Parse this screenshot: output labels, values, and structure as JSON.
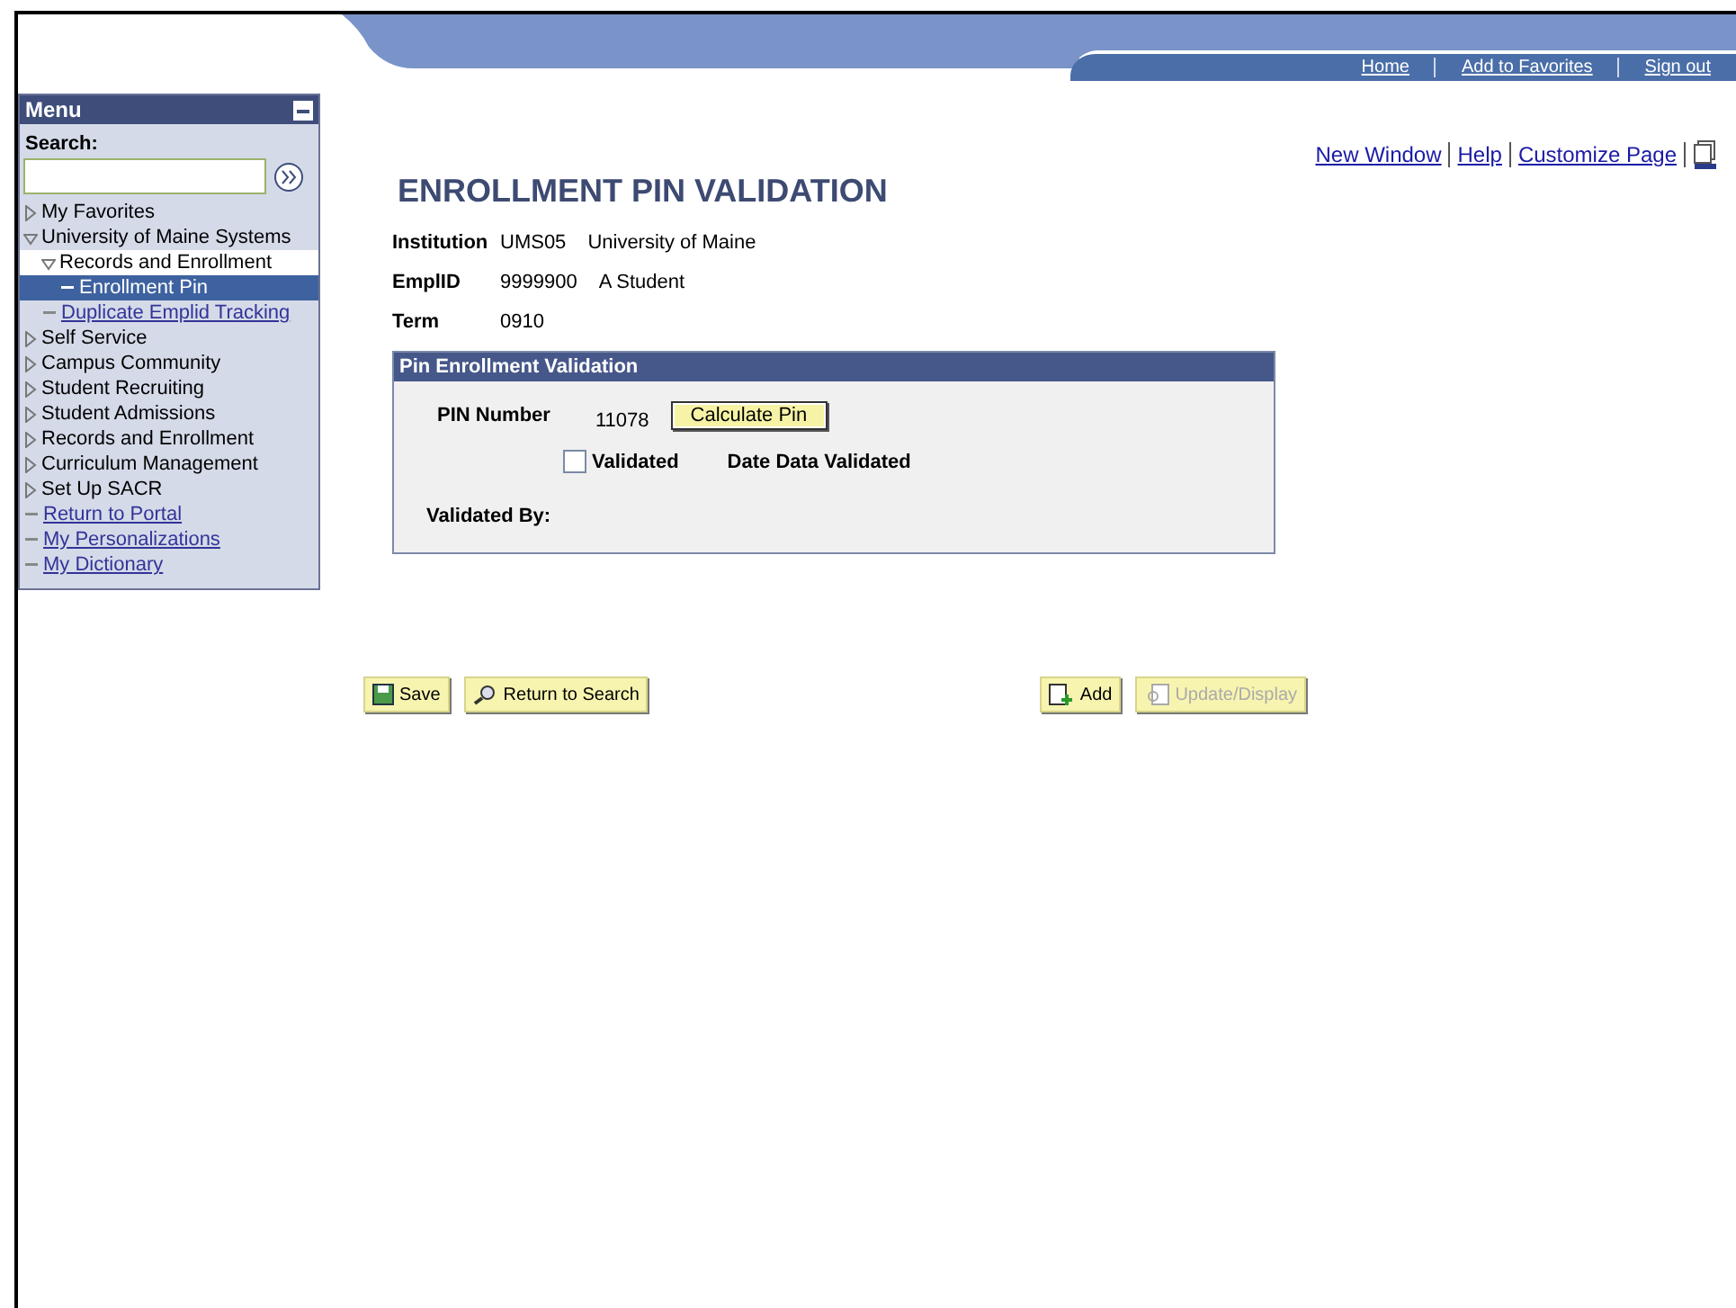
{
  "header": {
    "nav_links": [
      "Home",
      "Add to Favorites",
      "Sign out"
    ],
    "page_links": [
      "New Window",
      "Help",
      "Customize Page"
    ]
  },
  "menu": {
    "title": "Menu",
    "search_label": "Search:",
    "items": [
      {
        "label": "My Favorites",
        "kind": "folder",
        "expanded": false,
        "active": false,
        "selected": false
      },
      {
        "label": "University of Maine Systems",
        "kind": "folder",
        "expanded": true,
        "active": false,
        "selected": false,
        "children": [
          {
            "label": "Records and Enrollment",
            "kind": "folder",
            "expanded": true,
            "active": true,
            "selected": false,
            "children": [
              {
                "label": "Enrollment Pin",
                "kind": "link",
                "active": false,
                "selected": true
              }
            ]
          },
          {
            "label": "Duplicate Emplid Tracking",
            "kind": "link",
            "active": false,
            "selected": false
          }
        ]
      },
      {
        "label": "Self Service",
        "kind": "folder",
        "expanded": false,
        "active": false,
        "selected": false
      },
      {
        "label": "Campus Community",
        "kind": "folder",
        "expanded": false,
        "active": false,
        "selected": false
      },
      {
        "label": "Student Recruiting",
        "kind": "folder",
        "expanded": false,
        "active": false,
        "selected": false
      },
      {
        "label": "Student Admissions",
        "kind": "folder",
        "expanded": false,
        "active": false,
        "selected": false
      },
      {
        "label": "Records and Enrollment",
        "kind": "folder",
        "expanded": false,
        "active": false,
        "selected": false
      },
      {
        "label": "Curriculum Management",
        "kind": "folder",
        "expanded": false,
        "active": false,
        "selected": false
      },
      {
        "label": "Set Up SACR",
        "kind": "folder",
        "expanded": false,
        "active": false,
        "selected": false
      },
      {
        "label": "Return to Portal",
        "kind": "link",
        "active": false,
        "selected": false
      },
      {
        "label": "My Personalizations",
        "kind": "link",
        "active": false,
        "selected": false
      },
      {
        "label": "My Dictionary",
        "kind": "link",
        "active": false,
        "selected": false
      }
    ]
  },
  "page": {
    "title": "ENROLLMENT PIN VALIDATION",
    "fields": [
      {
        "label": "Institution",
        "values": [
          "UMS05",
          "University of Maine"
        ]
      },
      {
        "label": "EmplID",
        "values": [
          "9999900",
          "A Student"
        ]
      },
      {
        "label": "Term",
        "values": [
          "0910"
        ]
      }
    ],
    "group": {
      "title": "Pin Enrollment Validation",
      "pin_label": "PIN Number",
      "pin_value": "11078",
      "calc_button": "Calculate Pin",
      "validated": {
        "label": "Validated",
        "checked": false
      },
      "date_label": "Date Data Validated",
      "validated_by_label": "Validated By:"
    }
  },
  "buttons": [
    {
      "label": "Save",
      "kind": "save",
      "disabled": false
    },
    {
      "label": "Return to Search",
      "kind": "search",
      "disabled": false
    },
    {
      "label": "Add",
      "kind": "add",
      "disabled": false
    },
    {
      "label": "Update/Display",
      "kind": "update",
      "disabled": true
    }
  ]
}
